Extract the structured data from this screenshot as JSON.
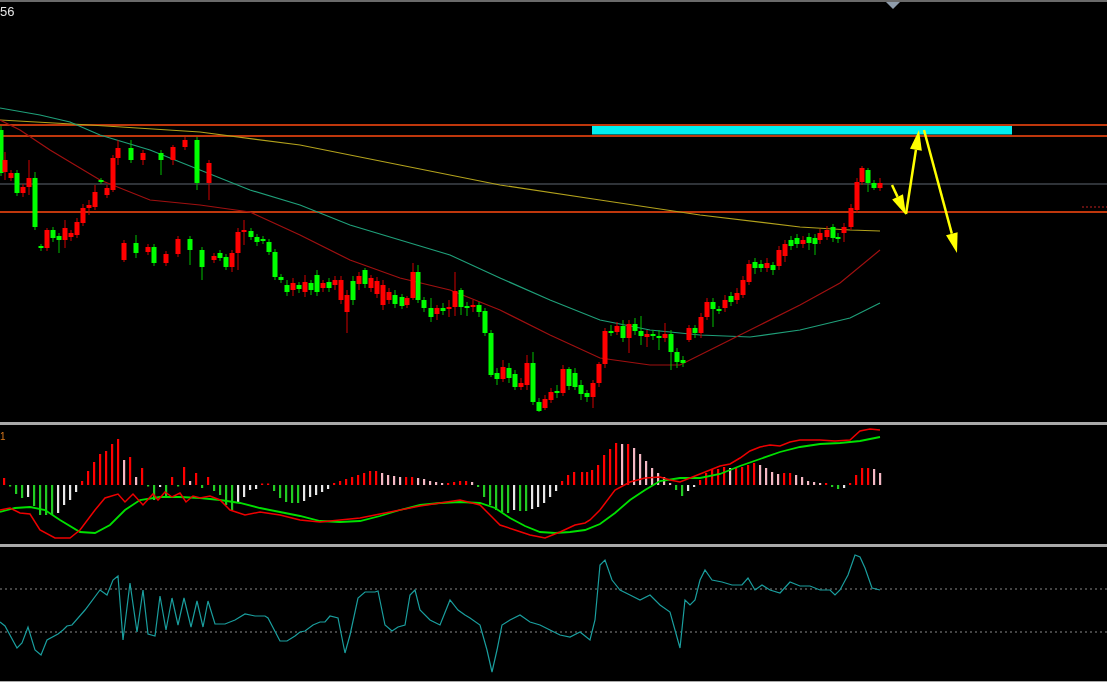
{
  "price_panel": {
    "label": "56"
  },
  "macd_panel": {
    "label": "1"
  }
}
